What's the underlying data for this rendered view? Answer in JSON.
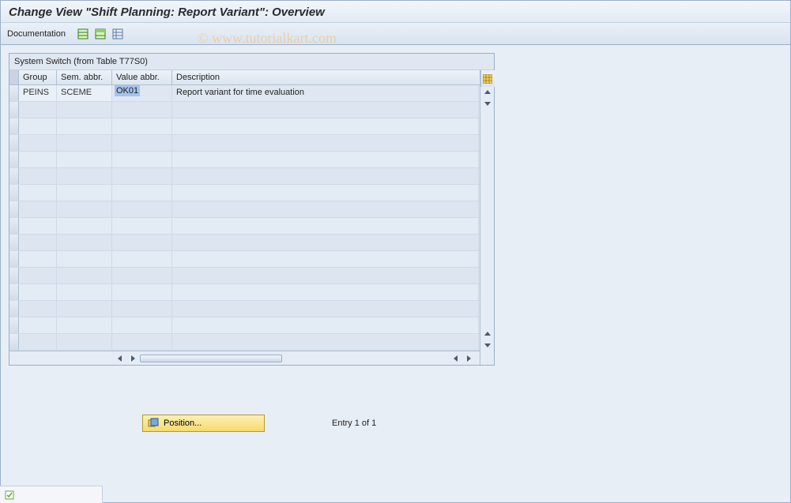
{
  "title": "Change View \"Shift Planning: Report Variant\": Overview",
  "toolbar": {
    "documentation_label": "Documentation"
  },
  "panel": {
    "title": "System Switch (from Table T77S0)",
    "columns": {
      "group": "Group",
      "sem": "Sem. abbr.",
      "val": "Value abbr.",
      "desc": "Description"
    }
  },
  "rows": [
    {
      "group": "PEINS",
      "sem": "SCEME",
      "val": "OK01",
      "desc": "Report variant for time evaluation"
    }
  ],
  "empty_row_count": 15,
  "position_button": "Position...",
  "entry_status": "Entry 1 of 1",
  "watermark": "© www.tutorialkart.com",
  "colors": {
    "accent": "#9aafc6",
    "header_bg": "#e8eef6",
    "button_bg": "#f5da6d"
  }
}
